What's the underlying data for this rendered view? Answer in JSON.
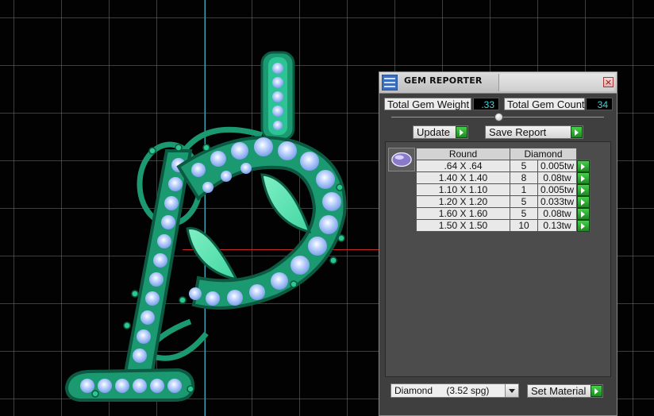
{
  "panel": {
    "title": "GEM REPORTER",
    "close_glyph": "×",
    "icon": "gem-reporter-icon"
  },
  "summary": {
    "weight_label": "Total Gem Weight",
    "weight_value": ".33",
    "count_label": "Total Gem Count",
    "count_value": "34"
  },
  "buttons": {
    "update": "Update",
    "save_report": "Save Report",
    "set_material": "Set Material"
  },
  "table": {
    "shape_header": "Round",
    "material_header": "Diamond",
    "rows": [
      {
        "size": ".64 X .64",
        "count": "5",
        "tw": "0.005tw"
      },
      {
        "size": "1.40 X 1.40",
        "count": "8",
        "tw": "0.08tw"
      },
      {
        "size": "1.10 X 1.10",
        "count": "1",
        "tw": "0.005tw"
      },
      {
        "size": "1.20 X 1.20",
        "count": "5",
        "tw": "0.033tw"
      },
      {
        "size": "1.60 X 1.60",
        "count": "5",
        "tw": "0.08tw"
      },
      {
        "size": "1.50 X 1.50",
        "count": "10",
        "tw": "0.13tw"
      }
    ]
  },
  "material": {
    "selected_name": "Diamond",
    "selected_sg": "(3.52 spg)"
  },
  "colors": {
    "metal": "#1c9f78",
    "stone": "#8fb4f6",
    "accent_value": "#3ad6e0",
    "go_arrow": "#2db233"
  }
}
